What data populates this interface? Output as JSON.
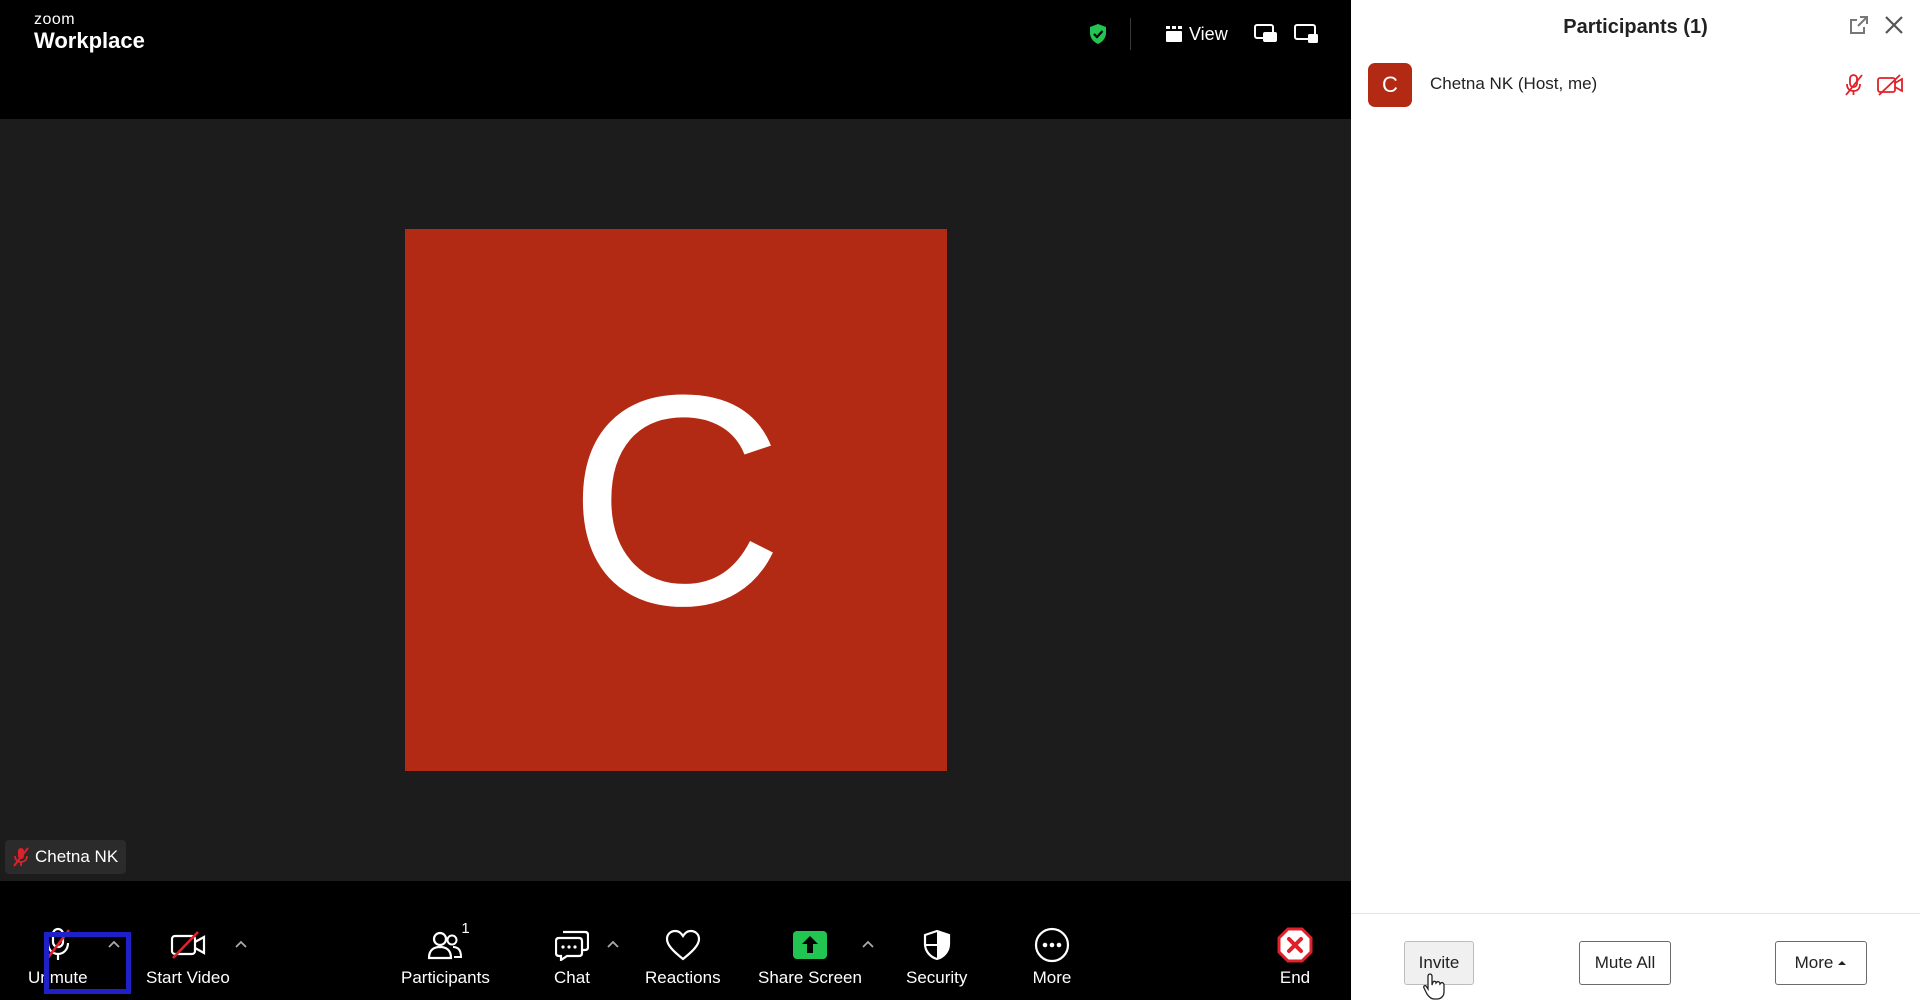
{
  "app": {
    "logo_line1": "zoom",
    "logo_line2": "Workplace"
  },
  "topbar": {
    "view_label": "View",
    "encryption_color": "#23c552"
  },
  "stage": {
    "avatar_letter": "C",
    "avatar_color": "#b32a14",
    "name_tag": "Chetna NK"
  },
  "toolbar": {
    "unmute_label": "Unmute",
    "start_video_label": "Start Video",
    "participants_label": "Participants",
    "participants_count": "1",
    "chat_label": "Chat",
    "reactions_label": "Reactions",
    "share_screen_label": "Share Screen",
    "share_color": "#23c552",
    "security_label": "Security",
    "more_label": "More",
    "end_label": "End",
    "end_color": "#e0202a"
  },
  "panel": {
    "title": "Participants (1)",
    "participants": [
      {
        "initial": "C",
        "name": "Chetna NK (Host, me)"
      }
    ],
    "invite_label": "Invite",
    "mute_all_label": "Mute All",
    "more_label": "More"
  }
}
